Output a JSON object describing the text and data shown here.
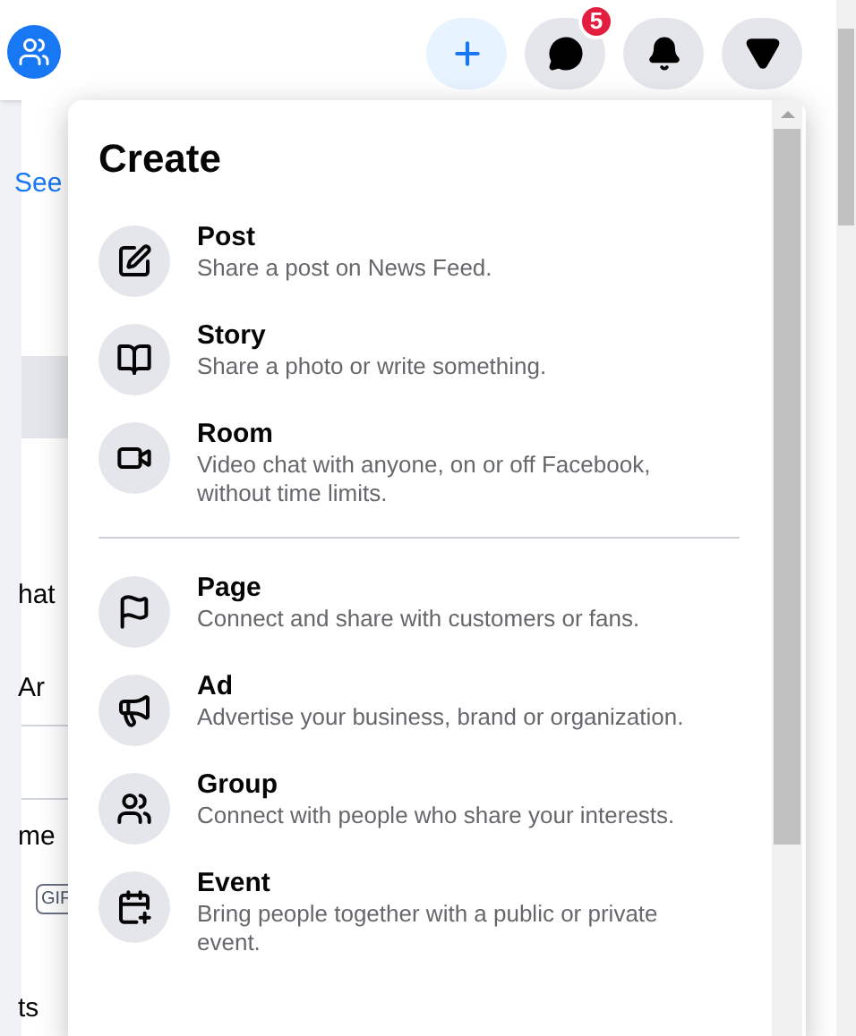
{
  "header": {
    "buttons": [
      {
        "kind": "create",
        "selected": true
      },
      {
        "kind": "messenger",
        "selected": false,
        "badge": "5"
      },
      {
        "kind": "notifications",
        "selected": false
      },
      {
        "kind": "account",
        "selected": false
      }
    ]
  },
  "background": {
    "fragments": [
      {
        "kind": "link",
        "text": "See"
      },
      {
        "kind": "text",
        "text": "hat"
      },
      {
        "kind": "text",
        "text": "Ar"
      },
      {
        "kind": "text",
        "text": "me"
      },
      {
        "kind": "tag",
        "text": "GIF"
      },
      {
        "kind": "text",
        "text": "ts"
      }
    ]
  },
  "menu": {
    "title": "Create",
    "sections": [
      [
        {
          "kind": "post",
          "title": "Post",
          "description": "Share a post on News Feed."
        },
        {
          "kind": "story",
          "title": "Story",
          "description": "Share a photo or write something."
        },
        {
          "kind": "room",
          "title": "Room",
          "description": "Video chat with anyone, on or off Facebook, without time limits."
        }
      ],
      [
        {
          "kind": "page",
          "title": "Page",
          "description": "Connect and share with customers or fans."
        },
        {
          "kind": "ad",
          "title": "Ad",
          "description": "Advertise your business, brand or organization."
        },
        {
          "kind": "group",
          "title": "Group",
          "description": "Connect with people who share your interests."
        },
        {
          "kind": "event",
          "title": "Event",
          "description": "Bring people together with a public or private event."
        }
      ]
    ]
  }
}
